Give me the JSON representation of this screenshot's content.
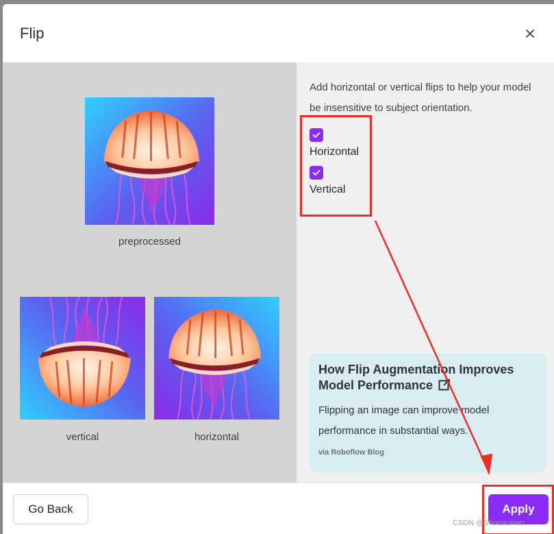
{
  "dialog": {
    "title": "Flip",
    "close_icon": "close-icon"
  },
  "previews": {
    "preprocessed_label": "preprocessed",
    "vertical_label": "vertical",
    "horizontal_label": "horizontal"
  },
  "options": {
    "description": "Add horizontal or vertical flips to help your model be insensitive to subject orientation.",
    "horizontal": {
      "label": "Horizontal",
      "checked": true
    },
    "vertical": {
      "label": "Vertical",
      "checked": true
    }
  },
  "blog": {
    "title": "How Flip Augmentation Improves Model Performance",
    "external_icon": "external-link-icon",
    "body": "Flipping an image can improve model performance in substantial ways.",
    "source": "via Roboflow Blog"
  },
  "footer": {
    "go_back_label": "Go Back",
    "apply_label": "Apply"
  },
  "watermark": "CSDN @Shixuxunwu",
  "colors": {
    "accent": "#8b2cf5",
    "annotation": "#ef2b22",
    "card_bg": "#d9ecf2"
  }
}
